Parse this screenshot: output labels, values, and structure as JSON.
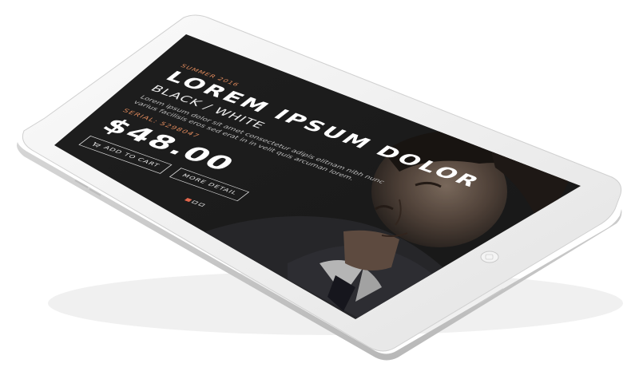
{
  "hero": {
    "eyebrow": "SUMMER 2016",
    "title": "LOREM IPSUM DOLOR",
    "variant": "BLACK / WHITE",
    "description": "Lorem ipsum dolor sit amet consectetur adipis elitnam nibh nunc varius facilisis eros sed erat in in velit quis arcuman lorem.",
    "serial": "SERIAL: 5298047",
    "price": "$48.00"
  },
  "buttons": {
    "add_to_cart": "ADD TO CART",
    "more_detail": "MORE DETAIL"
  },
  "slider": {
    "total": 3,
    "active": 1
  },
  "colors": {
    "accent": "#e08a5c",
    "active_dot": "#e2664c",
    "screen_bg": "#212121",
    "device_body": "#f2f2f2"
  },
  "icons": {
    "cart": "cart-icon",
    "camera": "camera-icon",
    "home": "home-button-icon"
  }
}
